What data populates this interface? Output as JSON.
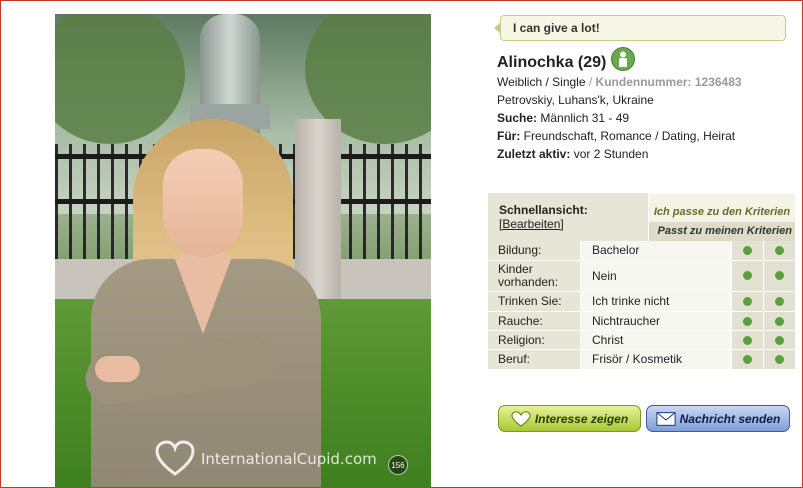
{
  "watermark": {
    "text": "InternationalCupid.com",
    "photo_count": "156"
  },
  "tagline": "I can give a lot!",
  "profile": {
    "name_age": "Alinochka (29)",
    "gender": "Weiblich",
    "separator": " / ",
    "status": "Single",
    "member_label": "Kundennummer: 1236483",
    "location": "Petrovskiy, Luhans'k, Ukraine",
    "seeking_label": "Suche:",
    "seeking_value": "Männlich 31 - 49",
    "for_label": "Für:",
    "for_value": "Freundschaft, Romance / Dating, Heirat",
    "last_active_label": "Zuletzt aktiv:",
    "last_active_value": "vor 2 Stunden"
  },
  "quickview": {
    "title": "Schnellansicht:",
    "edit_label": "[Bearbeiten]",
    "criteria_header_1": "Ich passe zu den Kriterien",
    "criteria_header_2": "Passt zu meinen Kriterien",
    "rows": [
      {
        "label": "Bildung:",
        "value": "Bachelor"
      },
      {
        "label": "Kinder vorhanden:",
        "value": "Nein"
      },
      {
        "label": "Trinken Sie:",
        "value": "Ich trinke nicht"
      },
      {
        "label": "Rauche:",
        "value": "Nichtraucher"
      },
      {
        "label": "Religion:",
        "value": "Christ"
      },
      {
        "label": "Beruf:",
        "value": "Frisör / Kosmetik"
      }
    ]
  },
  "actions": {
    "interest_label": "Interesse zeigen",
    "message_label": "Nachricht senden"
  },
  "colors": {
    "match_dot": "#5aa03c",
    "interest_button": "#a8c834",
    "message_button": "#7f9fd8"
  },
  "icons": [
    "online-status-icon",
    "heart-icon",
    "envelope-icon"
  ]
}
